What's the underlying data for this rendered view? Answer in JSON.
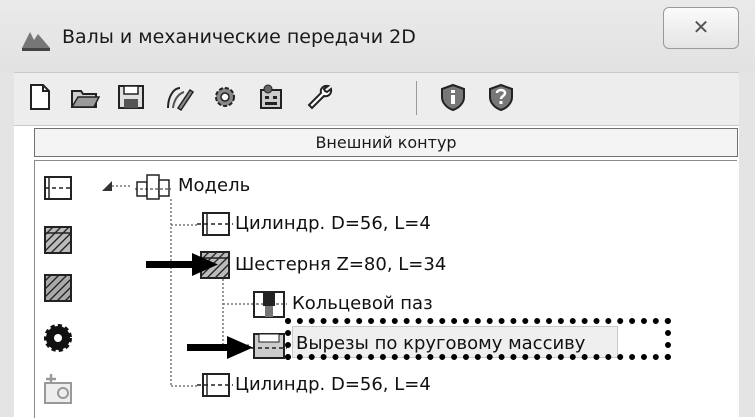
{
  "window": {
    "title": "Валы и механические передачи 2D",
    "close_glyph": "✕"
  },
  "toolbar": {
    "buttons": [
      "new-file-icon",
      "open-folder-icon",
      "save-icon",
      "edit-curve-icon",
      "gear-settings-icon",
      "calculator-icon",
      "wrench-icon",
      "info-shield-icon",
      "help-shield-icon"
    ]
  },
  "section": {
    "title": "Внешний контур"
  },
  "left_panel": {
    "buttons": [
      "cylinder-icon",
      "gear-section-icon",
      "hatched-section-icon",
      "gear-wheel-icon",
      "add-node-icon"
    ]
  },
  "tree": {
    "root": {
      "label": "Модель"
    },
    "items": [
      {
        "label": "Цилиндр. D=56, L=4"
      },
      {
        "label": "Шестерня Z=80, L=34"
      },
      {
        "label": "Кольцевой паз"
      },
      {
        "label": "Вырезы по круговому массиву"
      },
      {
        "label": "Цилиндр. D=56, L=4"
      }
    ]
  },
  "colors": {
    "accent_black": "#000000",
    "window_bg": "#ffffff",
    "frame": "#e4e4e4"
  }
}
